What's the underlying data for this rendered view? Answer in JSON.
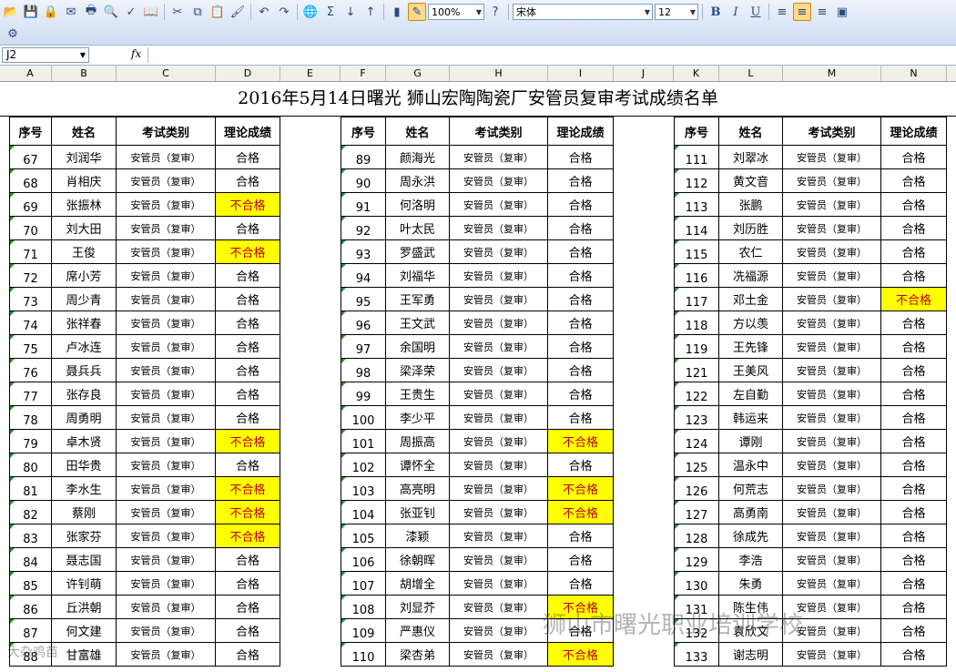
{
  "toolbar": {
    "zoom": "100%",
    "font_name": "宋体",
    "font_size": "12"
  },
  "formula_bar": {
    "name_box": "J2",
    "fx_label": "fx",
    "content": ""
  },
  "columns": [
    "A",
    "B",
    "C",
    "D",
    "E",
    "F",
    "G",
    "H",
    "I",
    "J",
    "K",
    "L",
    "M",
    "N"
  ],
  "title": "2016年5月14日曙光 狮山宏陶陶瓷厂安管员复审考试成绩名单",
  "headers": {
    "no": "序号",
    "name": "姓名",
    "category": "考试类别",
    "score": "理论成绩"
  },
  "category_text": "安管员（复审）",
  "pass_text": "合格",
  "fail_text": "不合格",
  "fail_color": "#ffff00",
  "groups": [
    {
      "rows": [
        {
          "no": "67",
          "name": "刘润华",
          "result": "合格"
        },
        {
          "no": "68",
          "name": "肖相庆",
          "result": "合格"
        },
        {
          "no": "69",
          "name": "张振林",
          "result": "不合格"
        },
        {
          "no": "70",
          "name": "刘大田",
          "result": "合格"
        },
        {
          "no": "71",
          "name": "王俊",
          "result": "不合格"
        },
        {
          "no": "72",
          "name": "席小芳",
          "result": "合格"
        },
        {
          "no": "73",
          "name": "周少青",
          "result": "合格"
        },
        {
          "no": "74",
          "name": "张祥春",
          "result": "合格"
        },
        {
          "no": "75",
          "name": "卢冰连",
          "result": "合格"
        },
        {
          "no": "76",
          "name": "聂兵兵",
          "result": "合格"
        },
        {
          "no": "77",
          "name": "张存良",
          "result": "合格"
        },
        {
          "no": "78",
          "name": "周勇明",
          "result": "合格"
        },
        {
          "no": "79",
          "name": "卓木贤",
          "result": "不合格"
        },
        {
          "no": "80",
          "name": "田华贵",
          "result": "合格"
        },
        {
          "no": "81",
          "name": "李水生",
          "result": "不合格"
        },
        {
          "no": "82",
          "name": "蔡刚",
          "result": "不合格"
        },
        {
          "no": "83",
          "name": "张家芬",
          "result": "不合格"
        },
        {
          "no": "84",
          "name": "聂志国",
          "result": "合格"
        },
        {
          "no": "85",
          "name": "许钊萌",
          "result": "合格"
        },
        {
          "no": "86",
          "name": "丘洪朝",
          "result": "合格"
        },
        {
          "no": "87",
          "name": "何文建",
          "result": "合格"
        },
        {
          "no": "88",
          "name": "甘富雄",
          "result": "合格"
        }
      ]
    },
    {
      "rows": [
        {
          "no": "89",
          "name": "颜海光",
          "result": "合格"
        },
        {
          "no": "90",
          "name": "周永洪",
          "result": "合格"
        },
        {
          "no": "91",
          "name": "何洛明",
          "result": "合格"
        },
        {
          "no": "92",
          "name": "叶太民",
          "result": "合格"
        },
        {
          "no": "93",
          "name": "罗盛武",
          "result": "合格"
        },
        {
          "no": "94",
          "name": "刘福华",
          "result": "合格"
        },
        {
          "no": "95",
          "name": "王军勇",
          "result": "合格"
        },
        {
          "no": "96",
          "name": "王文武",
          "result": "合格"
        },
        {
          "no": "97",
          "name": "余国明",
          "result": "合格"
        },
        {
          "no": "98",
          "name": "梁泽荣",
          "result": "合格"
        },
        {
          "no": "99",
          "name": "王贵生",
          "result": "合格"
        },
        {
          "no": "100",
          "name": "李少平",
          "result": "合格"
        },
        {
          "no": "101",
          "name": "周振高",
          "result": "不合格"
        },
        {
          "no": "102",
          "name": "谭怀全",
          "result": "合格"
        },
        {
          "no": "103",
          "name": "高亮明",
          "result": "不合格"
        },
        {
          "no": "104",
          "name": "张亚钊",
          "result": "不合格"
        },
        {
          "no": "105",
          "name": "漆颖",
          "result": "合格"
        },
        {
          "no": "106",
          "name": "徐朝晖",
          "result": "合格"
        },
        {
          "no": "107",
          "name": "胡增全",
          "result": "合格"
        },
        {
          "no": "108",
          "name": "刘显芥",
          "result": "不合格"
        },
        {
          "no": "109",
          "name": "严惠仪",
          "result": "合格"
        },
        {
          "no": "110",
          "name": "梁杏弟",
          "result": "不合格"
        }
      ]
    },
    {
      "rows": [
        {
          "no": "111",
          "name": "刘翠冰",
          "result": "合格"
        },
        {
          "no": "112",
          "name": "黄文音",
          "result": "合格"
        },
        {
          "no": "113",
          "name": "张鹏",
          "result": "合格"
        },
        {
          "no": "114",
          "name": "刘历胜",
          "result": "合格"
        },
        {
          "no": "115",
          "name": "农仁",
          "result": "合格"
        },
        {
          "no": "116",
          "name": "冼福源",
          "result": "合格"
        },
        {
          "no": "117",
          "name": "邓土金",
          "result": "不合格"
        },
        {
          "no": "118",
          "name": "方以羡",
          "result": "合格"
        },
        {
          "no": "119",
          "name": "王先锋",
          "result": "合格"
        },
        {
          "no": "121",
          "name": "王美风",
          "result": "合格"
        },
        {
          "no": "122",
          "name": "左自勤",
          "result": "合格"
        },
        {
          "no": "123",
          "name": "韩运来",
          "result": "合格"
        },
        {
          "no": "124",
          "name": "谭刚",
          "result": "合格"
        },
        {
          "no": "125",
          "name": "温永中",
          "result": "合格"
        },
        {
          "no": "126",
          "name": "何荒志",
          "result": "合格"
        },
        {
          "no": "127",
          "name": "高勇南",
          "result": "合格"
        },
        {
          "no": "128",
          "name": "徐成先",
          "result": "合格"
        },
        {
          "no": "129",
          "name": "李浩",
          "result": "合格"
        },
        {
          "no": "130",
          "name": "朱勇",
          "result": "合格"
        },
        {
          "no": "131",
          "name": "陈生伟",
          "result": "合格"
        },
        {
          "no": "132",
          "name": "袁欣文",
          "result": "合格"
        },
        {
          "no": "133",
          "name": "谢志明",
          "result": "合格"
        }
      ]
    }
  ],
  "watermark": "狮山市曙光职业培训学校",
  "watermark_small": "大杂鸡苗"
}
